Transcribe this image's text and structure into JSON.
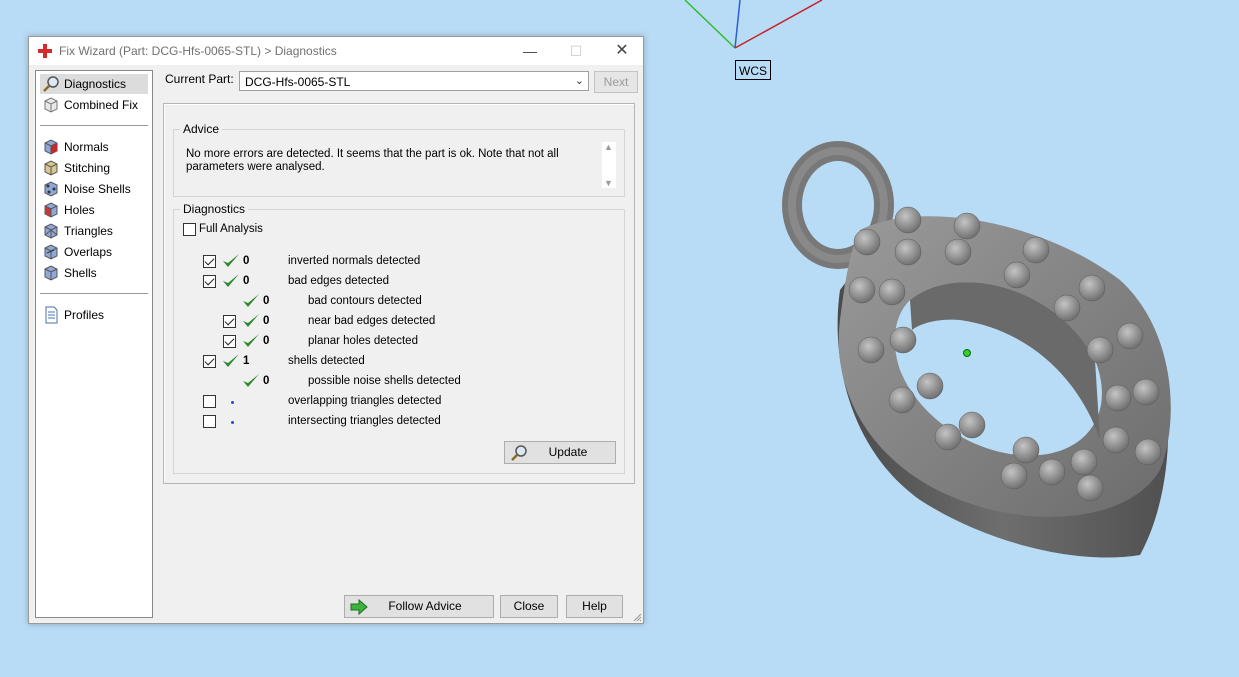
{
  "viewport": {
    "wcs_label": "WCS",
    "background": "#b9dcf6"
  },
  "dialog": {
    "title": "Fix Wizard (Part: DCG-Hfs-0065-STL) > Diagnostics",
    "window_controls": {
      "minimize": "—",
      "maximize": "☐",
      "close": "✕"
    }
  },
  "nav": {
    "items": [
      {
        "label": "Diagnostics",
        "icon": "magnifier-icon",
        "selected": true
      },
      {
        "label": "Combined Fix",
        "icon": "cube-icon"
      },
      {
        "label": "Normals",
        "icon": "normals-cube-icon"
      },
      {
        "label": "Stitching",
        "icon": "stitching-cube-icon"
      },
      {
        "label": "Noise Shells",
        "icon": "noise-shells-icon"
      },
      {
        "label": "Holes",
        "icon": "holes-cube-icon"
      },
      {
        "label": "Triangles",
        "icon": "triangles-cube-icon"
      },
      {
        "label": "Overlaps",
        "icon": "overlaps-cube-icon"
      },
      {
        "label": "Shells",
        "icon": "shells-cube-icon"
      },
      {
        "label": "Profiles",
        "icon": "document-icon"
      }
    ]
  },
  "current_part": {
    "label": "Current Part:",
    "value": "DCG-Hfs-0065-STL"
  },
  "next_button": "Next",
  "advice": {
    "title": "Advice",
    "text": "No more errors are detected. It seems that the part is ok. Note that not all parameters were analysed."
  },
  "diagnostics": {
    "title": "Diagnostics",
    "full_analysis_label": "Full Analysis",
    "rows": [
      {
        "checkbox": true,
        "checked": true,
        "status": "ok",
        "count": "0",
        "text": "inverted normals detected",
        "indent": 0
      },
      {
        "checkbox": true,
        "checked": true,
        "status": "ok",
        "count": "0",
        "text": "bad edges detected",
        "indent": 0
      },
      {
        "checkbox": false,
        "checked": false,
        "status": "ok",
        "count": "0",
        "text": "bad contours detected",
        "indent": 1
      },
      {
        "checkbox": true,
        "checked": true,
        "status": "ok",
        "count": "0",
        "text": "near bad edges detected",
        "indent": 1
      },
      {
        "checkbox": true,
        "checked": true,
        "status": "ok",
        "count": "0",
        "text": "planar holes detected",
        "indent": 1
      },
      {
        "checkbox": true,
        "checked": true,
        "status": "ok",
        "count": "1",
        "text": "shells detected",
        "indent": 0
      },
      {
        "checkbox": false,
        "checked": false,
        "status": "ok",
        "count": "0",
        "text": "possible noise shells detected",
        "indent": 1
      },
      {
        "checkbox": true,
        "checked": false,
        "status": "not-analysed",
        "count": "",
        "text": "overlapping triangles detected",
        "indent": 0
      },
      {
        "checkbox": true,
        "checked": false,
        "status": "not-analysed",
        "count": "",
        "text": "intersecting triangles detected",
        "indent": 0
      }
    ],
    "update_button": "Update"
  },
  "footer": {
    "follow_advice": "Follow Advice",
    "close": "Close",
    "help": "Help"
  },
  "colors": {
    "ok_tick": "#2f8a2f",
    "dot": "#1f4fd6",
    "accent_red": "#d42a2a"
  }
}
